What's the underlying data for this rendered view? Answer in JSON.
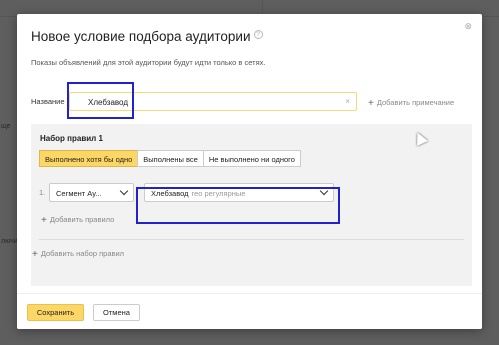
{
  "background": {
    "left_text_1": "ще",
    "left_text_2": "лючить"
  },
  "modal": {
    "title": "Новое условие подбора аудитории",
    "help_glyph": "?",
    "subtitle": "Показы объявлений для этой аудитории будут идти только в сетях.",
    "close_glyph": "⊗",
    "name_label": "Название",
    "name_value": "Хлебзавод",
    "clear_glyph": "×",
    "add_note_label": "Добавить примечание",
    "plus_glyph": "+"
  },
  "ruleset": {
    "title": "Набор правил 1",
    "tabs": [
      {
        "label": "Выполнено хотя бы одно",
        "active": true
      },
      {
        "label": "Выполнены все",
        "active": false
      },
      {
        "label": "Не выполнено ни одного",
        "active": false
      }
    ],
    "rule": {
      "number": "1.",
      "segment_type": "Сегмент Ау...",
      "segment_value": "Хлебзавод",
      "segment_hint": "гео регулярные"
    },
    "add_rule_label": "Добавить правило",
    "add_ruleset_label": "Добавить набор правил"
  },
  "footer": {
    "save_label": "Сохранить",
    "cancel_label": "Отмена"
  },
  "colors": {
    "accent_yellow": "#fdd766",
    "highlight_blue": "#2222cc"
  }
}
